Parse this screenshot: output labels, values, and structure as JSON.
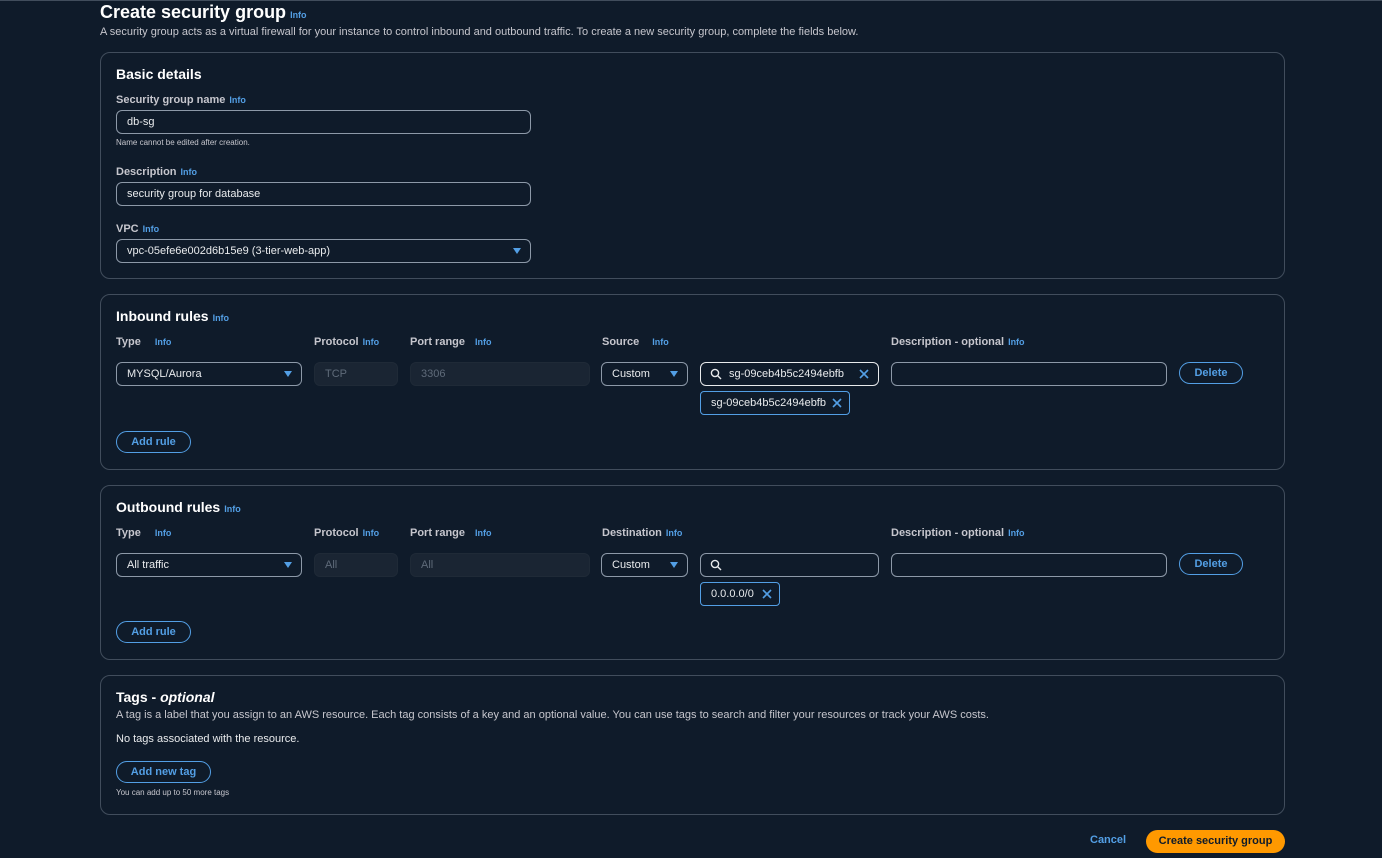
{
  "page": {
    "title": "Create security group",
    "title_info": "Info",
    "description": "A security group acts as a virtual firewall for your instance to control inbound and outbound traffic. To create a new security group, complete the fields below."
  },
  "basic": {
    "title": "Basic details",
    "name_label": "Security group name",
    "name_info": "Info",
    "name_value": "db-sg",
    "name_hint": "Name cannot be edited after creation.",
    "desc_label": "Description",
    "desc_info": "Info",
    "desc_value": "security group for database",
    "vpc_label": "VPC",
    "vpc_info": "Info",
    "vpc_value": "vpc-05efe6e002d6b15e9 (3-tier-web-app)"
  },
  "inbound": {
    "title": "Inbound rules",
    "title_info": "Info",
    "col_type": "Type",
    "col_protocol": "Protocol",
    "col_port": "Port range",
    "col_source": "Source",
    "col_desc": "Description - optional",
    "info": "Info",
    "type_value": "MYSQL/Aurora",
    "protocol_value": "TCP",
    "port_value": "3306",
    "source_value": "Custom",
    "search_value": "sg-09ceb4b5c2494ebfb",
    "token_value": "sg-09ceb4b5c2494ebfb",
    "desc_value": "",
    "delete_label": "Delete",
    "add_rule_label": "Add rule"
  },
  "outbound": {
    "title": "Outbound rules",
    "title_info": "Info",
    "col_type": "Type",
    "col_protocol": "Protocol",
    "col_port": "Port range",
    "col_dest": "Destination",
    "col_desc": "Description - optional",
    "info": "Info",
    "type_value": "All traffic",
    "protocol_value": "All",
    "port_value": "All",
    "dest_value": "Custom",
    "search_value": "",
    "token_value": "0.0.0.0/0",
    "desc_value": "",
    "delete_label": "Delete",
    "add_rule_label": "Add rule"
  },
  "tags": {
    "title_main": "Tags - ",
    "title_em": "optional",
    "description": "A tag is a label that you assign to an AWS resource. Each tag consists of a key and an optional value. You can use tags to search and filter your resources or track your AWS costs.",
    "empty": "No tags associated with the resource.",
    "add_label": "Add new tag",
    "limit_hint": "You can add up to 50 more tags"
  },
  "footer": {
    "cancel_label": "Cancel",
    "create_label": "Create security group"
  },
  "colors": {
    "background": "#0f1b2a",
    "accent": "#539fe5",
    "primary_button": "#ff9900",
    "border": "#414d5c"
  }
}
